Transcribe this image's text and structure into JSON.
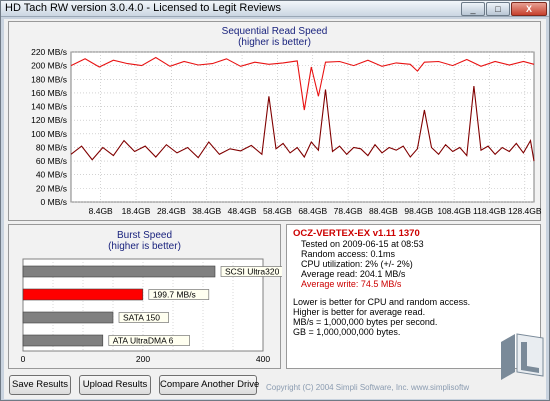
{
  "window": {
    "title": "HD Tach RW version 3.0.4.0 - Licensed to Legit Reviews",
    "minimize": "_",
    "maximize": "□",
    "close": "X"
  },
  "read_chart": {
    "title": "Sequential Read Speed",
    "subtitle": "(higher is better)",
    "colors": {
      "read": "#e81212",
      "access": "#800000",
      "grid": "#b8b8b8"
    }
  },
  "burst_chart": {
    "title": "Burst Speed",
    "subtitle": "(higher is better)"
  },
  "chart_data": [
    {
      "type": "line",
      "title": "Sequential Read Speed",
      "subtitle": "(higher is better)",
      "ylabel_unit": "MB/s",
      "ylim": [
        0,
        220
      ],
      "y_ticks": [
        "220 MB/s",
        "200 MB/s",
        "180 MB/s",
        "160 MB/s",
        "140 MB/s",
        "120 MB/s",
        "100 MB/s",
        "80 MB/s",
        "60 MB/s",
        "40 MB/s",
        "20 MB/s",
        "0 MB/s"
      ],
      "x_ticks": [
        "8.4GB",
        "18.4GB",
        "28.4GB",
        "38.4GB",
        "48.4GB",
        "58.4GB",
        "68.4GB",
        "78.4GB",
        "88.4GB",
        "98.4GB",
        "108.4GB",
        "118.4GB",
        "128.4GB"
      ],
      "grid": true,
      "series": [
        {
          "color": "#e81212",
          "x": [
            0,
            4,
            8,
            12,
            16,
            20,
            24,
            28,
            32,
            36,
            40,
            44,
            48,
            52,
            56,
            60,
            64,
            66,
            68,
            70,
            72,
            76,
            80,
            84,
            88,
            92,
            96,
            98,
            100,
            104,
            108,
            112,
            116,
            120,
            124,
            128,
            131
          ],
          "y": [
            200,
            210,
            198,
            208,
            203,
            200,
            212,
            199,
            206,
            201,
            203,
            210,
            199,
            205,
            202,
            204,
            207,
            135,
            198,
            155,
            205,
            206,
            200,
            208,
            199,
            204,
            202,
            192,
            205,
            206,
            200,
            209,
            199,
            206,
            201,
            206,
            202
          ]
        },
        {
          "color": "#800000",
          "x": [
            0,
            3,
            6,
            9,
            12,
            15,
            18,
            21,
            24,
            27,
            30,
            33,
            36,
            39,
            42,
            45,
            48,
            51,
            54,
            56,
            58,
            60,
            62,
            64,
            66,
            68,
            70,
            72,
            74,
            76,
            78,
            80,
            82,
            84,
            86,
            88,
            90,
            92,
            94,
            96,
            98,
            100,
            102,
            104,
            106,
            108,
            110,
            112,
            114,
            116,
            118,
            120,
            122,
            124,
            126,
            128,
            130,
            131
          ],
          "y": [
            70,
            82,
            62,
            80,
            68,
            90,
            74,
            82,
            66,
            84,
            72,
            80,
            65,
            88,
            70,
            78,
            75,
            83,
            70,
            155,
            78,
            86,
            72,
            80,
            66,
            88,
            76,
            165,
            74,
            82,
            70,
            80,
            78,
            68,
            84,
            72,
            80,
            76,
            82,
            66,
            78,
            135,
            80,
            70,
            84,
            74,
            80,
            68,
            170,
            76,
            82,
            70,
            80,
            74,
            86,
            72,
            90,
            60
          ]
        }
      ]
    },
    {
      "type": "bar",
      "title": "Burst Speed",
      "subtitle": "(higher is better)",
      "categories": [
        "SCSI Ultra320",
        "199.7 MB/s",
        "SATA 150",
        "ATA UltraDMA 6"
      ],
      "values": [
        320,
        199.7,
        150,
        133
      ],
      "colors": [
        "#808080",
        "#ff0000",
        "#808080",
        "#808080"
      ],
      "x_ticks": [
        "0",
        "200",
        "400"
      ],
      "xlim": [
        0,
        400
      ]
    }
  ],
  "info": {
    "drive": "OCZ-VERTEX-EX v1.11 1370",
    "tested": "Tested on 2009-06-15 at 08:53",
    "random_access": "Random access: 0.1ms",
    "cpu": "CPU utilization: 2% (+/- 2%)",
    "avg_read": "Average read: 204.1 MB/s",
    "avg_write": "Average write: 74.5 MB/s",
    "note1": "Lower is better for CPU and random access.",
    "note2": "Higher is better for average read.",
    "note3": "MB/s = 1,000,000 bytes per second.",
    "note4": "GB = 1,000,000,000 bytes."
  },
  "buttons": {
    "save": "Save Results",
    "upload": "Upload Results",
    "compare": "Compare Another Drive"
  },
  "footer": "Copyright (C) 2004 Simpli Software, Inc. www.simplisoftw",
  "logo": {
    "text": "LEGIT REVIEWS",
    "colors": {
      "dark": "#7a8a99",
      "light": "#e9edf1"
    }
  }
}
